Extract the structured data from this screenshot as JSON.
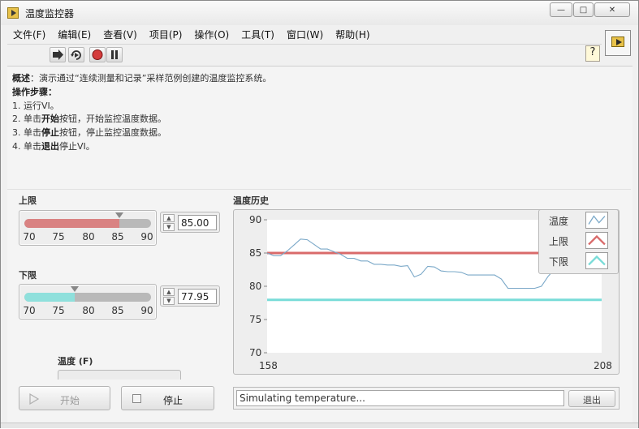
{
  "window": {
    "title": "温度监控器",
    "controls": {
      "minimize": "—",
      "maximize": "□",
      "close": "✕"
    }
  },
  "menu": [
    "文件(F)",
    "编辑(E)",
    "查看(V)",
    "项目(P)",
    "操作(O)",
    "工具(T)",
    "窗口(W)",
    "帮助(H)"
  ],
  "toolbar": {
    "buttons": [
      "run-arrow-icon",
      "run-continuously-icon",
      "abort-icon",
      "pause-icon"
    ],
    "help": "?"
  },
  "description": {
    "summary_label": "概述",
    "summary_text": "：演示通过“连续测量和记录”采样范例创建的温度监控系统。",
    "steps_label": "操作步骤：",
    "step1": "1. 运行VI。",
    "step2_pre": "2. 单击",
    "step2_bold": "开始",
    "step2_post": "按钮，开始监控温度数据。",
    "step3_pre": "3. 单击",
    "step3_bold": "停止",
    "step3_post": "按钮，停止监控温度数据。",
    "step4_pre": "4. 单击",
    "step4_bold": "退出",
    "step4_post": "停止VI。"
  },
  "upper_limit": {
    "label": "上限",
    "value": "85.00",
    "level": 85.0,
    "min": 70,
    "max": 90,
    "ticks": [
      "70",
      "75",
      "80",
      "85",
      "90"
    ],
    "fill_color": "#d98282"
  },
  "lower_limit": {
    "label": "下限",
    "value": "77.95",
    "level": 77.95,
    "min": 70,
    "max": 90,
    "ticks": [
      "70",
      "75",
      "80",
      "85",
      "90"
    ],
    "fill_color": "#8fe0dc"
  },
  "temperature_indicator": {
    "label": "温度 (F)"
  },
  "buttons": {
    "start": "开始",
    "stop": "停止",
    "exit": "退出"
  },
  "status": {
    "text": "Simulating temperature..."
  },
  "chart": {
    "label": "温度历史",
    "legend": [
      {
        "name": "温度",
        "color": "#7aa8c8"
      },
      {
        "name": "上限",
        "color": "#d96a6a"
      },
      {
        "name": "下限",
        "color": "#79dcd8"
      }
    ]
  },
  "chart_data": {
    "type": "line",
    "title": "温度历史",
    "xlabel": "",
    "ylabel": "",
    "xlim": [
      158,
      208
    ],
    "ylim": [
      70,
      90
    ],
    "x_ticks": [
      "158",
      "208"
    ],
    "y_ticks": [
      "90",
      "85",
      "80",
      "75",
      "70"
    ],
    "legend_position": "top-right",
    "series": [
      {
        "name": "温度",
        "color": "#7aa8c8",
        "x": [
          158,
          159,
          160,
          161,
          162,
          163,
          164,
          165,
          166,
          167,
          168,
          169,
          170,
          171,
          172,
          173,
          174,
          175,
          176,
          177,
          178,
          179,
          180,
          181,
          182,
          183,
          184,
          185,
          186,
          187,
          188,
          189,
          190,
          191,
          192,
          193,
          194,
          195,
          196,
          197,
          198,
          199,
          200,
          201,
          202,
          203,
          204,
          205
        ],
        "y": [
          85.0,
          84.6,
          84.6,
          85.3,
          86.2,
          87.1,
          87.0,
          86.3,
          85.6,
          85.6,
          85.2,
          84.8,
          84.2,
          84.2,
          83.8,
          83.8,
          83.3,
          83.3,
          83.2,
          83.2,
          83.0,
          83.1,
          81.4,
          81.8,
          83.0,
          82.9,
          82.3,
          82.2,
          82.2,
          82.1,
          81.7,
          81.7,
          81.7,
          81.7,
          81.7,
          81.1,
          79.7,
          79.7,
          79.7,
          79.7,
          79.7,
          80.0,
          81.5,
          82.6,
          84.2,
          85.4,
          86.0,
          86.2
        ]
      },
      {
        "name": "上限",
        "color": "#d96a6a",
        "x": [
          158,
          208
        ],
        "y": [
          85.0,
          85.0
        ]
      },
      {
        "name": "下限",
        "color": "#79dcd8",
        "x": [
          158,
          208
        ],
        "y": [
          77.95,
          77.95
        ]
      }
    ]
  }
}
